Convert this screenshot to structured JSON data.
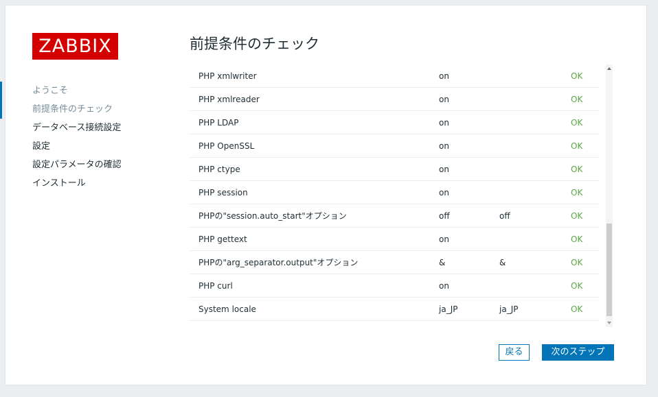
{
  "logo": {
    "text": "ZABBIX"
  },
  "steps": [
    {
      "label": "ようこそ"
    },
    {
      "label": "前提条件のチェック"
    },
    {
      "label": "データベース接続設定"
    },
    {
      "label": "設定"
    },
    {
      "label": "設定パラメータの確認"
    },
    {
      "label": "インストール"
    }
  ],
  "page": {
    "title": "前提条件のチェック"
  },
  "checks": [
    {
      "name": "PHP xmlwriter",
      "current": "on",
      "required": "",
      "result": "OK"
    },
    {
      "name": "PHP xmlreader",
      "current": "on",
      "required": "",
      "result": "OK"
    },
    {
      "name": "PHP LDAP",
      "current": "on",
      "required": "",
      "result": "OK"
    },
    {
      "name": "PHP OpenSSL",
      "current": "on",
      "required": "",
      "result": "OK"
    },
    {
      "name": "PHP ctype",
      "current": "on",
      "required": "",
      "result": "OK"
    },
    {
      "name": "PHP session",
      "current": "on",
      "required": "",
      "result": "OK"
    },
    {
      "name": "PHPの\"session.auto_start\"オプション",
      "current": "off",
      "required": "off",
      "result": "OK"
    },
    {
      "name": "PHP gettext",
      "current": "on",
      "required": "",
      "result": "OK"
    },
    {
      "name": "PHPの\"arg_separator.output\"オプション",
      "current": "&",
      "required": "&",
      "result": "OK"
    },
    {
      "name": "PHP curl",
      "current": "on",
      "required": "",
      "result": "OK"
    },
    {
      "name": "System locale",
      "current": "ja_JP",
      "required": "ja_JP",
      "result": "OK"
    }
  ],
  "buttons": {
    "back": "戻る",
    "next": "次のステップ"
  },
  "colors": {
    "brand": "#d40000",
    "accent": "#0275b8",
    "ok": "#59a646",
    "muted": "#768d99"
  }
}
